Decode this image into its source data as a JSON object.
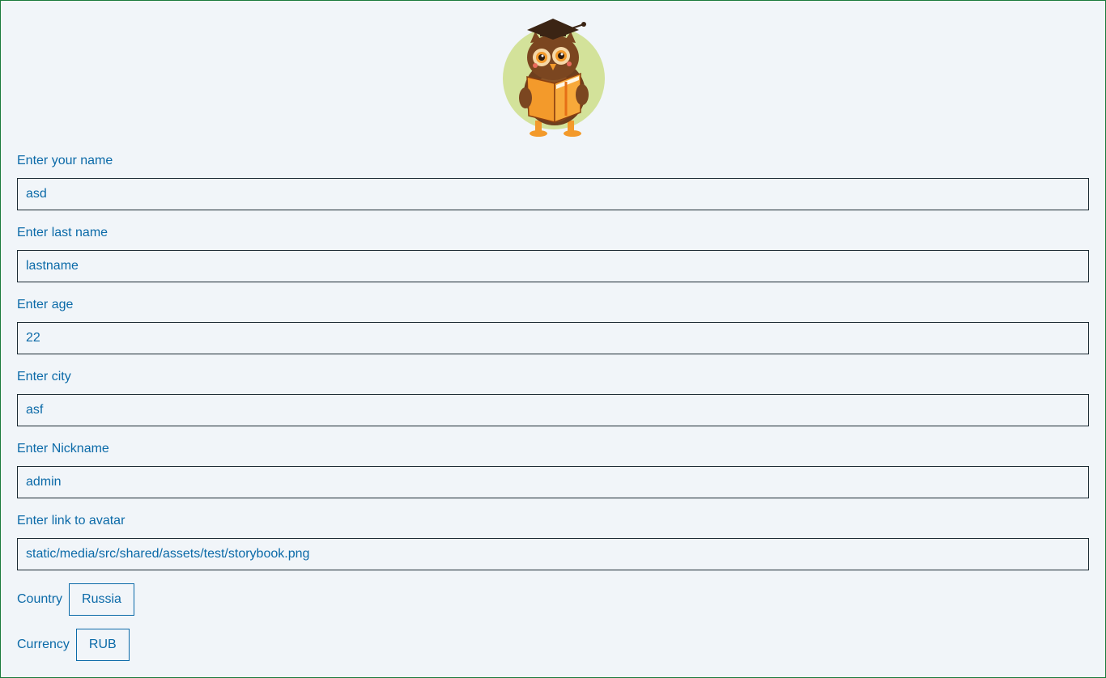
{
  "profile": {
    "avatar_icon": "owl-reading-book",
    "fields": [
      {
        "label": "Enter your name",
        "value": "asd"
      },
      {
        "label": "Enter last name",
        "value": "lastname"
      },
      {
        "label": "Enter age",
        "value": "22"
      },
      {
        "label": "Enter city",
        "value": "asf"
      },
      {
        "label": "Enter Nickname",
        "value": "admin"
      },
      {
        "label": "Enter link to avatar",
        "value": "static/media/src/shared/assets/test/storybook.png"
      }
    ],
    "country": {
      "label": "Country",
      "value": "Russia"
    },
    "currency": {
      "label": "Currency",
      "value": "RUB"
    }
  },
  "colors": {
    "accent": "#0b6aa8",
    "background": "#f1f5f9",
    "frame_border": "#1a7a3c"
  }
}
